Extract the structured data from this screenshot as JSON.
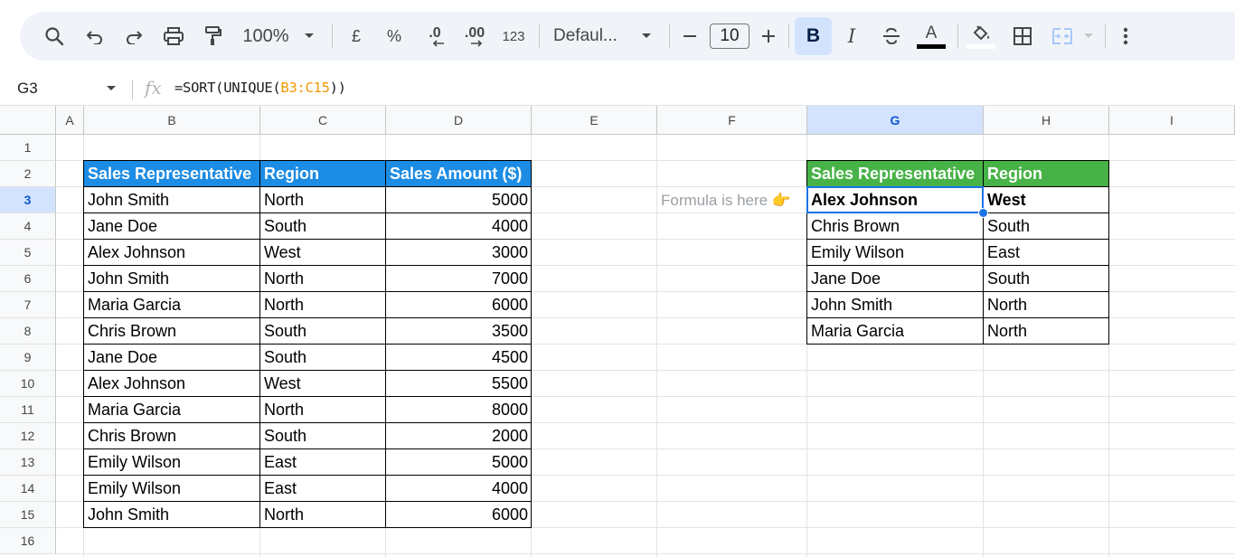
{
  "toolbar": {
    "zoom": "100%",
    "currency": "£",
    "percent": "%",
    "decrease_decimal": ".0",
    "increase_decimal": ".00",
    "number_format": "123",
    "font": "Defaul...",
    "font_size": "10",
    "bold": "B",
    "italic": "I",
    "text_color_letter": "A"
  },
  "formula_bar": {
    "name_box": "G3",
    "fx": "fx",
    "formula_prefix": "=SORT(UNIQUE(",
    "formula_ref": "B3:C15",
    "formula_suffix": "))"
  },
  "columns": [
    "A",
    "B",
    "C",
    "D",
    "E",
    "F",
    "G",
    "H",
    "I"
  ],
  "rows": [
    "1",
    "2",
    "3",
    "4",
    "5",
    "6",
    "7",
    "8",
    "9",
    "10",
    "11",
    "12",
    "13",
    "14",
    "15",
    "16"
  ],
  "selected_column": "G",
  "selected_row": "3",
  "source_table": {
    "headers": [
      "Sales Representative",
      "Region",
      "Sales Amount ($)"
    ],
    "header_color": "#1c8ce4",
    "rows": [
      [
        "John Smith",
        "North",
        "5000"
      ],
      [
        "Jane Doe",
        "South",
        "4000"
      ],
      [
        "Alex Johnson",
        "West",
        "3000"
      ],
      [
        "John Smith",
        "North",
        "7000"
      ],
      [
        "Maria Garcia",
        "North",
        "6000"
      ],
      [
        "Chris Brown",
        "South",
        "3500"
      ],
      [
        "Jane Doe",
        "South",
        "4500"
      ],
      [
        "Alex Johnson",
        "West",
        "5500"
      ],
      [
        "Maria Garcia",
        "North",
        "8000"
      ],
      [
        "Chris Brown",
        "South",
        "2000"
      ],
      [
        "Emily Wilson",
        "East",
        "5000"
      ],
      [
        "Emily Wilson",
        "East",
        "4000"
      ],
      [
        "John Smith",
        "North",
        "6000"
      ]
    ]
  },
  "result_table": {
    "headers": [
      "Sales Representative",
      "Region"
    ],
    "header_color": "#47b247",
    "rows": [
      [
        "Alex Johnson",
        "West"
      ],
      [
        "Chris Brown",
        "South"
      ],
      [
        "Emily Wilson",
        "East"
      ],
      [
        "Jane Doe",
        "South"
      ],
      [
        "John Smith",
        "North"
      ],
      [
        "Maria Garcia",
        "North"
      ]
    ]
  },
  "note": "Formula is here 👉",
  "colors": {
    "selection": "#1a73e8",
    "formula_ref": "#f29900"
  }
}
